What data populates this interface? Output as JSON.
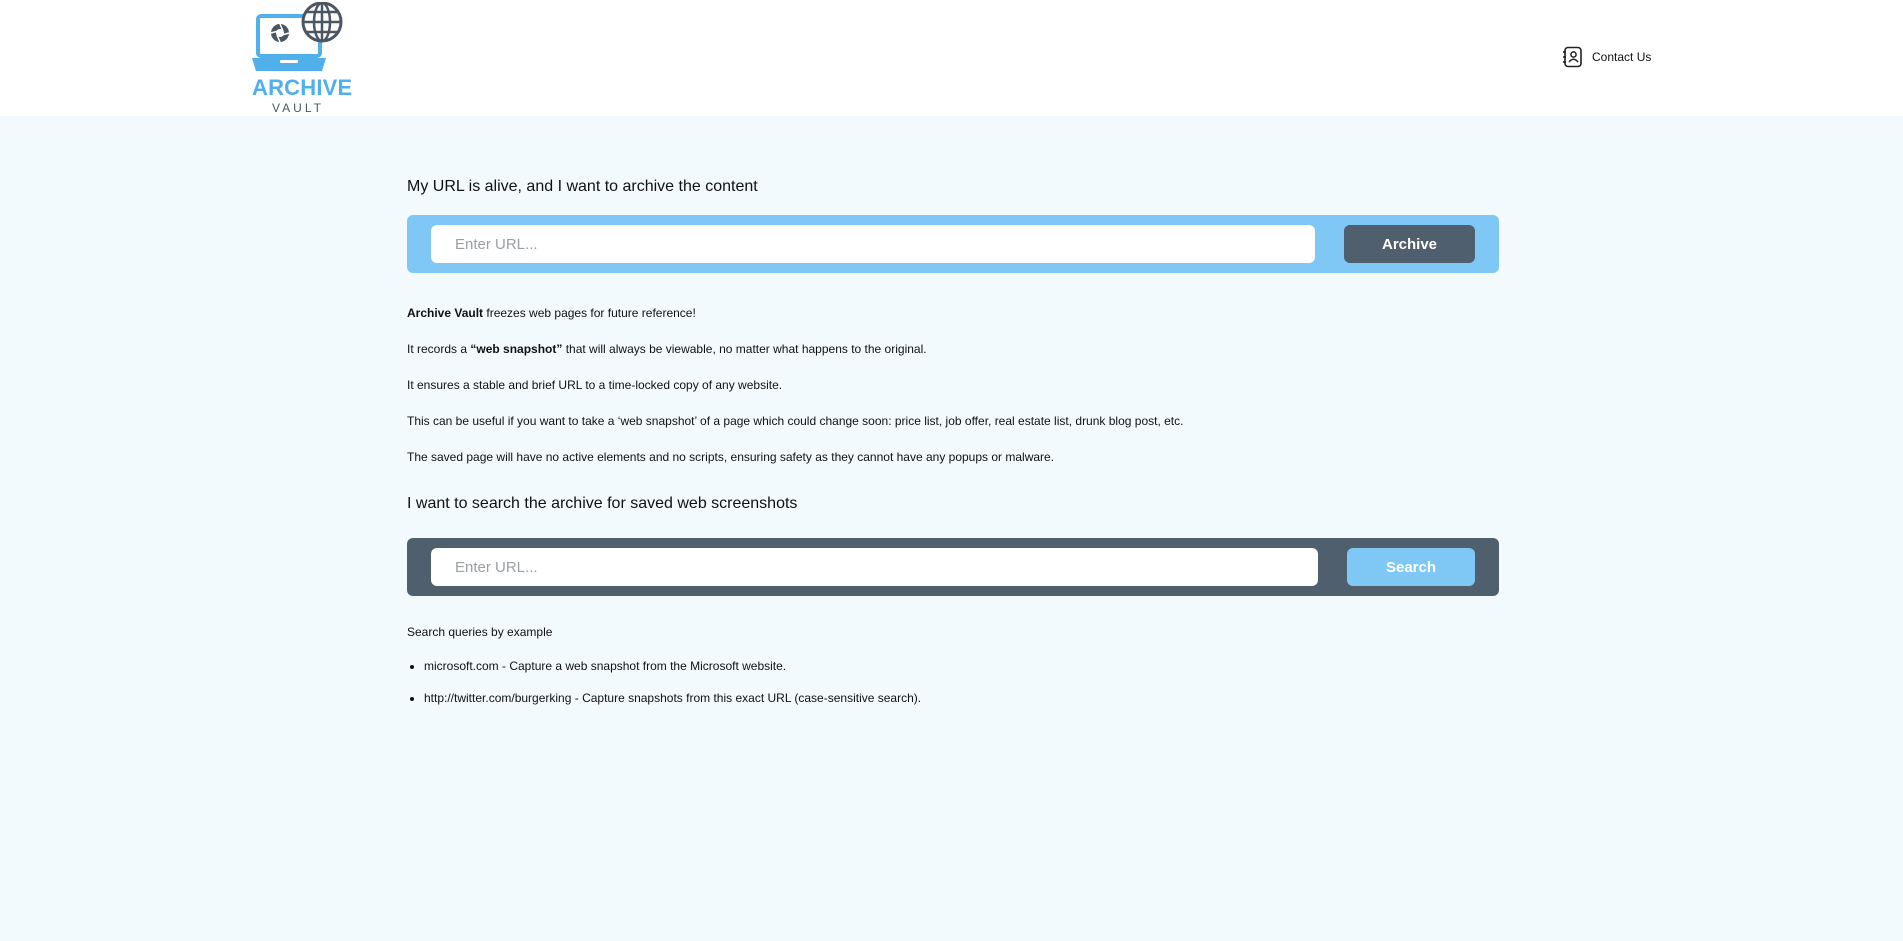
{
  "header": {
    "logo": {
      "word": "ARCHIVE",
      "sub": "VAULT",
      "colors": {
        "primary": "#4fb0ec",
        "dark": "#4b5663"
      }
    },
    "contact": {
      "label": "Contact Us",
      "icon": "contact-card-icon"
    }
  },
  "archive_section": {
    "title": "My URL is alive, and I want to archive the content",
    "input_placeholder": "Enter URL...",
    "input_value": "",
    "button_label": "Archive",
    "bar_color": "#7fc8f5",
    "button_color": "#4f5f6e"
  },
  "description": {
    "p1_strong": "Archive Vault",
    "p1_rest": " freezes web pages for future reference!",
    "p2_pre": "It records a ",
    "p2_strong": "“web snapshot”",
    "p2_post": " that will always be viewable, no matter what happens to the original.",
    "p3": "It ensures a stable and brief URL to a time-locked copy of any website.",
    "p4": "This can be useful if you want to take a ‘web snapshot’ of a page which could change soon: price list, job offer, real estate list, drunk blog post, etc.",
    "p5": "The saved page will have no active elements and no scripts, ensuring safety as they cannot have any popups or malware."
  },
  "search_section": {
    "title": "I want to search the archive for saved web screenshots",
    "input_placeholder": "Enter URL...",
    "input_value": "",
    "button_label": "Search",
    "bar_color": "#4f5f6e",
    "button_color": "#7fc8f5"
  },
  "examples": {
    "heading": "Search queries by example",
    "items": [
      {
        "text": "microsoft.com - Capture a web snapshot from the Microsoft website."
      },
      {
        "text": "http://twitter.com/burgerking - Capture snapshots from this exact URL (case-sensitive search)."
      }
    ]
  }
}
